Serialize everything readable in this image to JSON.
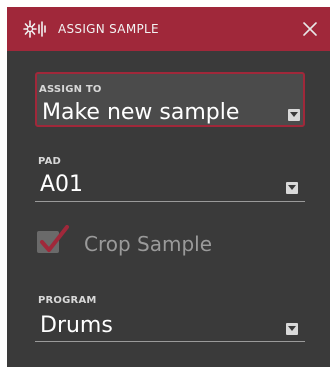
{
  "dialog": {
    "title": "ASSIGN SAMPLE",
    "icon": "waveform-burst-icon",
    "close_icon": "close-icon"
  },
  "assign_to": {
    "label": "ASSIGN TO",
    "value": "Make new sample",
    "highlighted": true
  },
  "pad": {
    "label": "PAD",
    "value": "A01"
  },
  "crop_sample": {
    "label": "Crop Sample",
    "checked": true
  },
  "program": {
    "label": "PROGRAM",
    "value": "Drums"
  },
  "colors": {
    "accent": "#a0283a",
    "background": "#3a3a3a",
    "text": "#ffffff",
    "muted_text": "#9a9a9a"
  }
}
